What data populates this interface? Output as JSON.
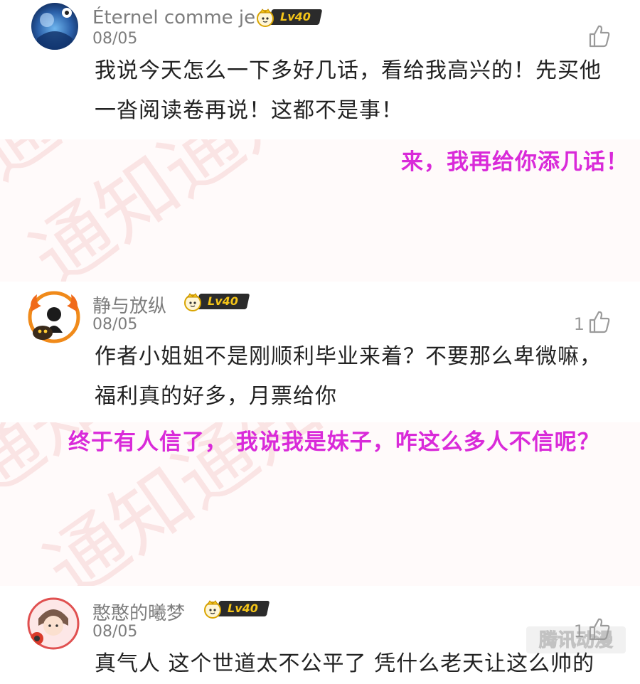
{
  "comments": [
    {
      "username": "Éternel comme je",
      "level": "Lv40",
      "date": "08/05",
      "likes": "",
      "text_lines": [
        "我说今天怎么一下多好几话，看给我高兴的！先买他",
        "一沓阅读卷再说！这都不是事！"
      ]
    },
    {
      "username": "静与放纵",
      "level": "Lv40",
      "date": "08/05",
      "likes": "1",
      "text_lines": [
        "作者小姐姐不是刚顺利毕业来着？不要那么卑微嘛，",
        "福利真的好多，月票给你"
      ]
    },
    {
      "username": "憨憨的曦梦",
      "level": "Lv40",
      "date": "08/05",
      "likes": "1",
      "text_lines": [
        "真气人 这个世道太不公平了 凭什么老天让这么帅的"
      ]
    }
  ],
  "replies": [
    "来，我再给你添几话！",
    "终于有人信了， 我说我是妹子，咋这么多人不信呢？"
  ],
  "watermark_text": "通知通知通知通知通知通知",
  "brand": "腾讯动漫",
  "colors": {
    "reply": "#d92ad9",
    "meta": "#7d7d7d",
    "badge_bg": "#2b2b2b",
    "badge_text": "#f5c518",
    "watermark": "#f2b8b8"
  },
  "icons": [
    "thumbs-up-icon",
    "crown-icon"
  ]
}
